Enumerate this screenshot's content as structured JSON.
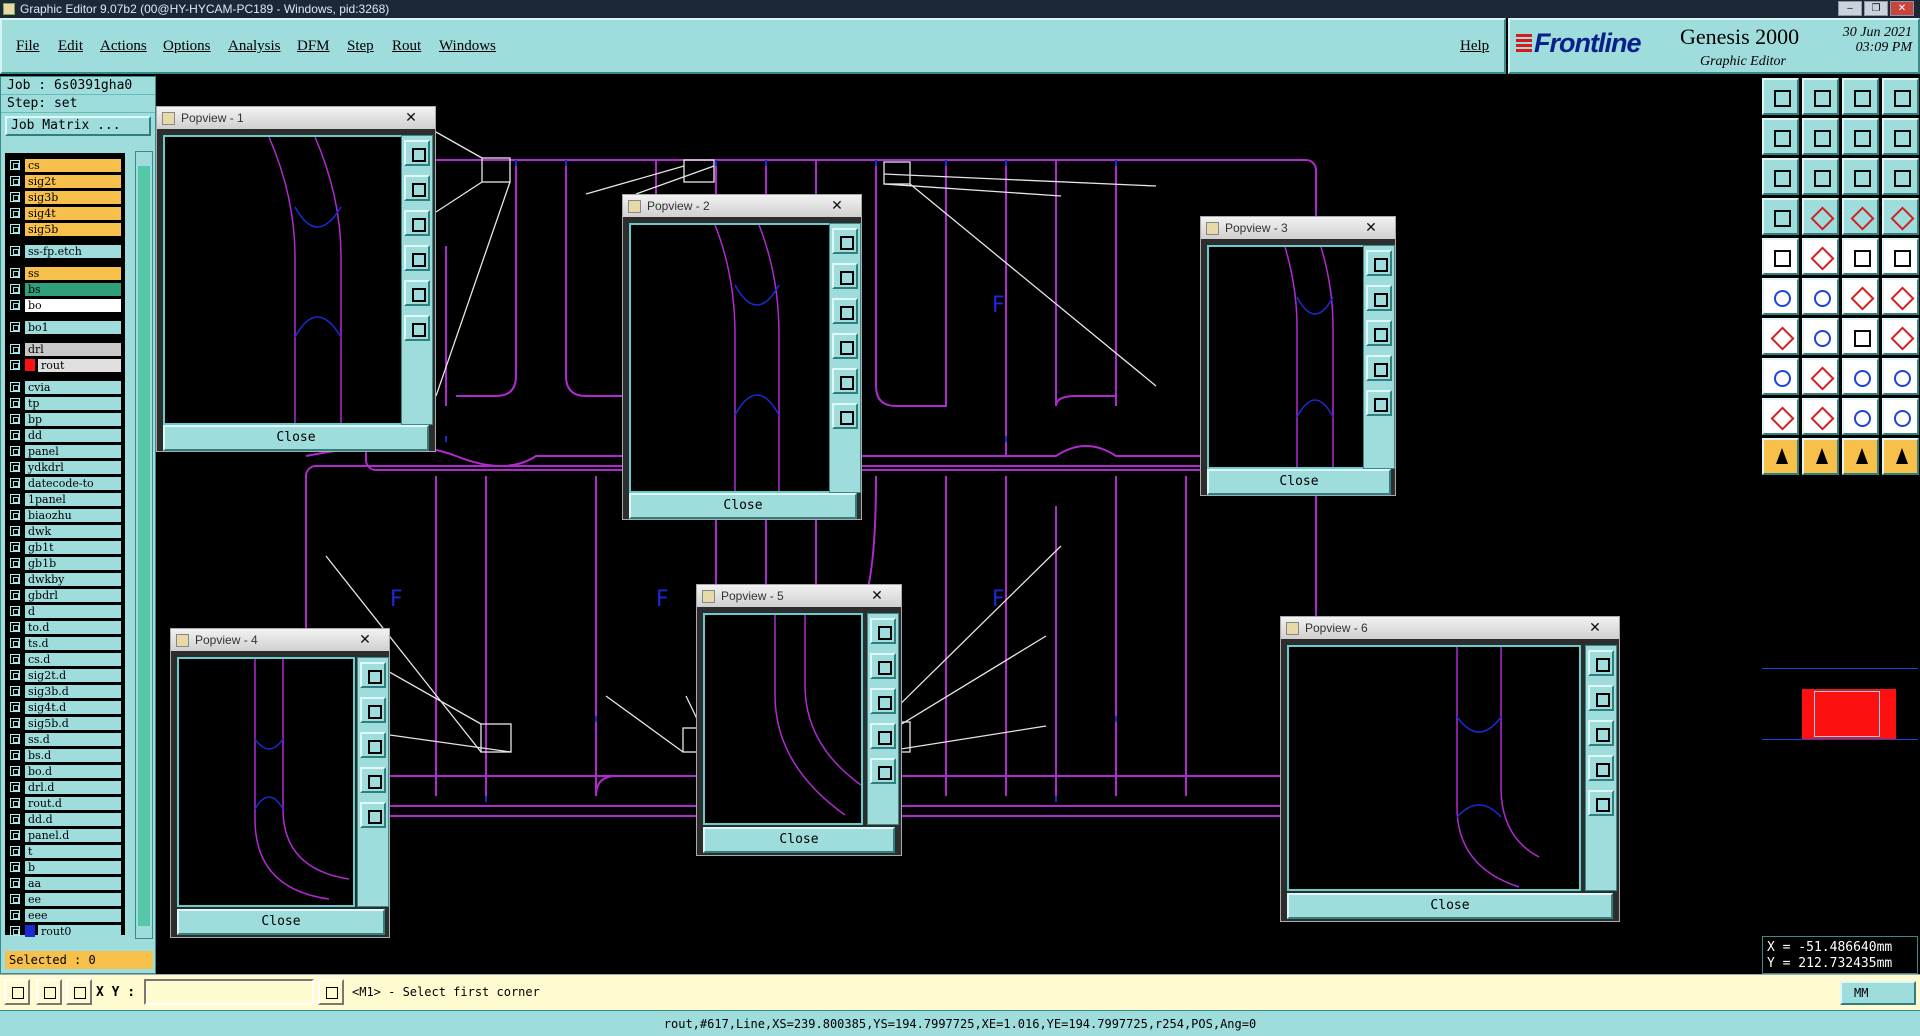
{
  "window": {
    "title": "Graphic Editor 9.07b2 (00@HY-HYCAM-PC189 - Windows, pid:3268)"
  },
  "menu": [
    "File",
    "Edit",
    "Actions",
    "Options",
    "Analysis",
    "DFM",
    "Step",
    "Rout",
    "Windows"
  ],
  "help": "Help",
  "brand": {
    "logo": "Frontline",
    "product": "Genesis 2000",
    "subtitle": "Graphic Editor",
    "date": "30 Jun 2021",
    "time": "03:09 PM"
  },
  "job": {
    "job_line": "Job : 6s0391gha0",
    "step_line": "Step: set",
    "matrix_button": "Job Matrix ..."
  },
  "layers": [
    {
      "name": "cs",
      "color": "#f6c04a",
      "gap": false
    },
    {
      "name": "sig2t",
      "color": "#f6c04a",
      "gap": false
    },
    {
      "name": "sig3b",
      "color": "#f6c04a",
      "gap": false
    },
    {
      "name": "sig4t",
      "color": "#f6c04a",
      "gap": false
    },
    {
      "name": "sig5b",
      "color": "#f6c04a",
      "gap": false
    },
    {
      "name": "ss-fp.etch",
      "color": "#9fdcdc",
      "gap": true
    },
    {
      "name": "ss",
      "color": "#f6c04a",
      "gap": true
    },
    {
      "name": "bs",
      "color": "#2fa07a",
      "gap": false
    },
    {
      "name": "bo",
      "color": "#ffffff",
      "gap": false
    },
    {
      "name": "bo1",
      "color": "#9fdcdc",
      "gap": true
    },
    {
      "name": "drl",
      "color": "#c8c8c8",
      "gap": true
    },
    {
      "name": "rout",
      "color": "#e0e0e0",
      "gap": false,
      "active": true
    },
    {
      "name": "cvia",
      "color": "#9fdcdc",
      "gap": true
    },
    {
      "name": "tp",
      "color": "#9fdcdc",
      "gap": false
    },
    {
      "name": "bp",
      "color": "#9fdcdc",
      "gap": false
    },
    {
      "name": "dd",
      "color": "#9fdcdc",
      "gap": false
    },
    {
      "name": "panel",
      "color": "#9fdcdc",
      "gap": false
    },
    {
      "name": "ydkdrl",
      "color": "#9fdcdc",
      "gap": false
    },
    {
      "name": "datecode-to",
      "color": "#9fdcdc",
      "gap": false
    },
    {
      "name": "1panel",
      "color": "#9fdcdc",
      "gap": false
    },
    {
      "name": "biaozhu",
      "color": "#9fdcdc",
      "gap": false
    },
    {
      "name": "dwk",
      "color": "#9fdcdc",
      "gap": false
    },
    {
      "name": "gb1t",
      "color": "#9fdcdc",
      "gap": false
    },
    {
      "name": "gb1b",
      "color": "#9fdcdc",
      "gap": false
    },
    {
      "name": "dwkby",
      "color": "#9fdcdc",
      "gap": false
    },
    {
      "name": "gbdrl",
      "color": "#9fdcdc",
      "gap": false
    },
    {
      "name": "d",
      "color": "#9fdcdc",
      "gap": false
    },
    {
      "name": "to.d",
      "color": "#9fdcdc",
      "gap": false
    },
    {
      "name": "ts.d",
      "color": "#9fdcdc",
      "gap": false
    },
    {
      "name": "cs.d",
      "color": "#9fdcdc",
      "gap": false
    },
    {
      "name": "sig2t.d",
      "color": "#9fdcdc",
      "gap": false
    },
    {
      "name": "sig3b.d",
      "color": "#9fdcdc",
      "gap": false
    },
    {
      "name": "sig4t.d",
      "color": "#9fdcdc",
      "gap": false
    },
    {
      "name": "sig5b.d",
      "color": "#9fdcdc",
      "gap": false
    },
    {
      "name": "ss.d",
      "color": "#9fdcdc",
      "gap": false
    },
    {
      "name": "bs.d",
      "color": "#9fdcdc",
      "gap": false
    },
    {
      "name": "bo.d",
      "color": "#9fdcdc",
      "gap": false
    },
    {
      "name": "drl.d",
      "color": "#9fdcdc",
      "gap": false
    },
    {
      "name": "rout.d",
      "color": "#9fdcdc",
      "gap": false
    },
    {
      "name": "dd.d",
      "color": "#9fdcdc",
      "gap": false
    },
    {
      "name": "panel.d",
      "color": "#9fdcdc",
      "gap": false
    },
    {
      "name": "t",
      "color": "#9fdcdc",
      "gap": false
    },
    {
      "name": "b",
      "color": "#9fdcdc",
      "gap": false
    },
    {
      "name": "aa",
      "color": "#9fdcdc",
      "gap": false
    },
    {
      "name": "ee",
      "color": "#9fdcdc",
      "gap": false
    },
    {
      "name": "eee",
      "color": "#9fdcdc",
      "gap": false
    },
    {
      "name": "rout0",
      "color": "#9fdcdc",
      "gap": false,
      "swatch": "#1c2ad6"
    }
  ],
  "selected": "Selected : 0",
  "popviews": [
    {
      "title": "Popview - 1",
      "close": "Close"
    },
    {
      "title": "Popview - 2",
      "close": "Close"
    },
    {
      "title": "Popview - 3",
      "close": "Close"
    },
    {
      "title": "Popview - 4",
      "close": "Close"
    },
    {
      "title": "Popview - 5",
      "close": "Close"
    },
    {
      "title": "Popview - 6",
      "close": "Close"
    }
  ],
  "canvas_marks": [
    "F",
    "F",
    "F",
    "F",
    "F"
  ],
  "coords": {
    "x": "X = -51.486640mm",
    "y": "Y = 212.732435mm"
  },
  "cmd": {
    "xy_label": "X Y :",
    "prompt": "<M1> - Select first corner",
    "units": "MM"
  },
  "status": "rout,#617,Line,XS=239.800385,YS=194.7997725,XE=1.016,YE=194.7997725,r254,POS,Ang=0",
  "colors": {
    "panel": "#9fdcdc",
    "rout": "#b02ad0",
    "pads": "#1c2ad6",
    "highlight": "#f6c04a"
  }
}
